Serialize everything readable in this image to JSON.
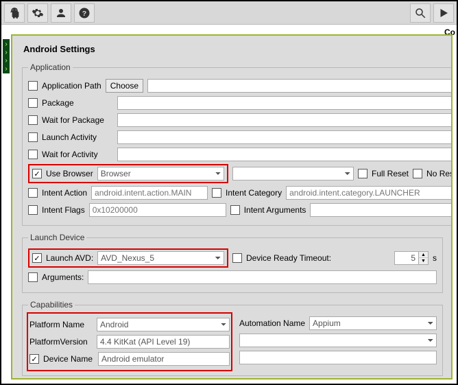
{
  "title": "Android Settings",
  "rightHint": "Co",
  "application": {
    "legend": "Application",
    "appPath": "Application Path",
    "choose": "Choose",
    "package": "Package",
    "waitPackage": "Wait for Package",
    "launchActivity": "Launch Activity",
    "waitActivity": "Wait for Activity",
    "useBrowser": "Use Browser",
    "browserValue": "Browser",
    "fullReset": "Full Reset",
    "noReset": "No Reset",
    "intentAction": "Intent Action",
    "intentActionPh": "android.intent.action.MAIN",
    "intentCategory": "Intent Category",
    "intentCategoryPh": "android.intent.category.LAUNCHER",
    "intentFlags": "Intent Flags",
    "intentFlagsPh": "0x10200000",
    "intentArgs": "Intent Arguments"
  },
  "launchDevice": {
    "legend": "Launch Device",
    "launchAvd": "Launch AVD:",
    "avdValue": "AVD_Nexus_5",
    "deviceReady": "Device Ready Timeout:",
    "deviceReadyVal": "5",
    "unit": "s",
    "arguments": "Arguments:"
  },
  "capabilities": {
    "legend": "Capabilities",
    "platformName": "Platform Name",
    "platformNameVal": "Android",
    "automationName": "Automation Name",
    "automationNameVal": "Appium",
    "platformVersion": "PlatformVersion",
    "platformVersionVal": "4.4 KitKat (API Level 19)",
    "deviceName": "Device Name",
    "deviceNameVal": "Android emulator"
  }
}
